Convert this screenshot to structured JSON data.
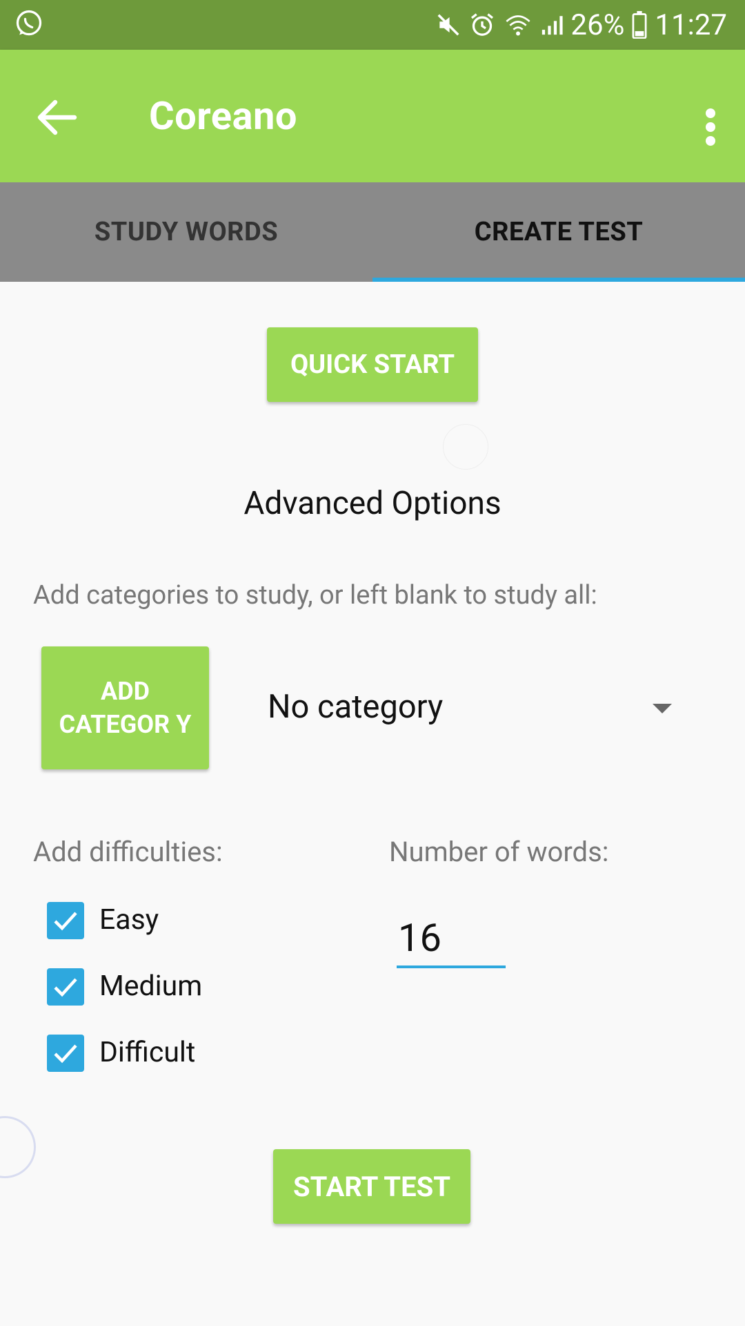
{
  "status_bar": {
    "battery": "26%",
    "time": "11:27",
    "icons": [
      "whatsapp-icon",
      "mute-icon",
      "alarm-icon",
      "wifi-icon",
      "signal-icon",
      "battery-icon"
    ]
  },
  "app_bar": {
    "title": "Coreano",
    "back_icon": "arrow-back-icon",
    "menu_icon": "more-vert-icon"
  },
  "tabs": [
    {
      "label": "STUDY WORDS",
      "active": false
    },
    {
      "label": "CREATE TEST",
      "active": true
    }
  ],
  "main": {
    "quick_start_label": "QUICK START",
    "advanced_title": "Advanced Options",
    "categories_hint": "Add categories to study, or left blank to study all:",
    "add_category_label": "ADD CATEGOR Y",
    "category_selected": "No category",
    "difficulties_label": "Add difficulties:",
    "difficulties": [
      {
        "label": "Easy",
        "checked": true
      },
      {
        "label": "Medium",
        "checked": true
      },
      {
        "label": "Difficult",
        "checked": true
      }
    ],
    "number_label": "Number of words:",
    "number_value": "16",
    "start_test_label": "START TEST"
  },
  "colors": {
    "status_bar": "#6e9a3b",
    "app_bar": "#9bd854",
    "tab_bar": "#8a8a8a",
    "accent": "#2ea8de",
    "button": "#9bd854"
  }
}
